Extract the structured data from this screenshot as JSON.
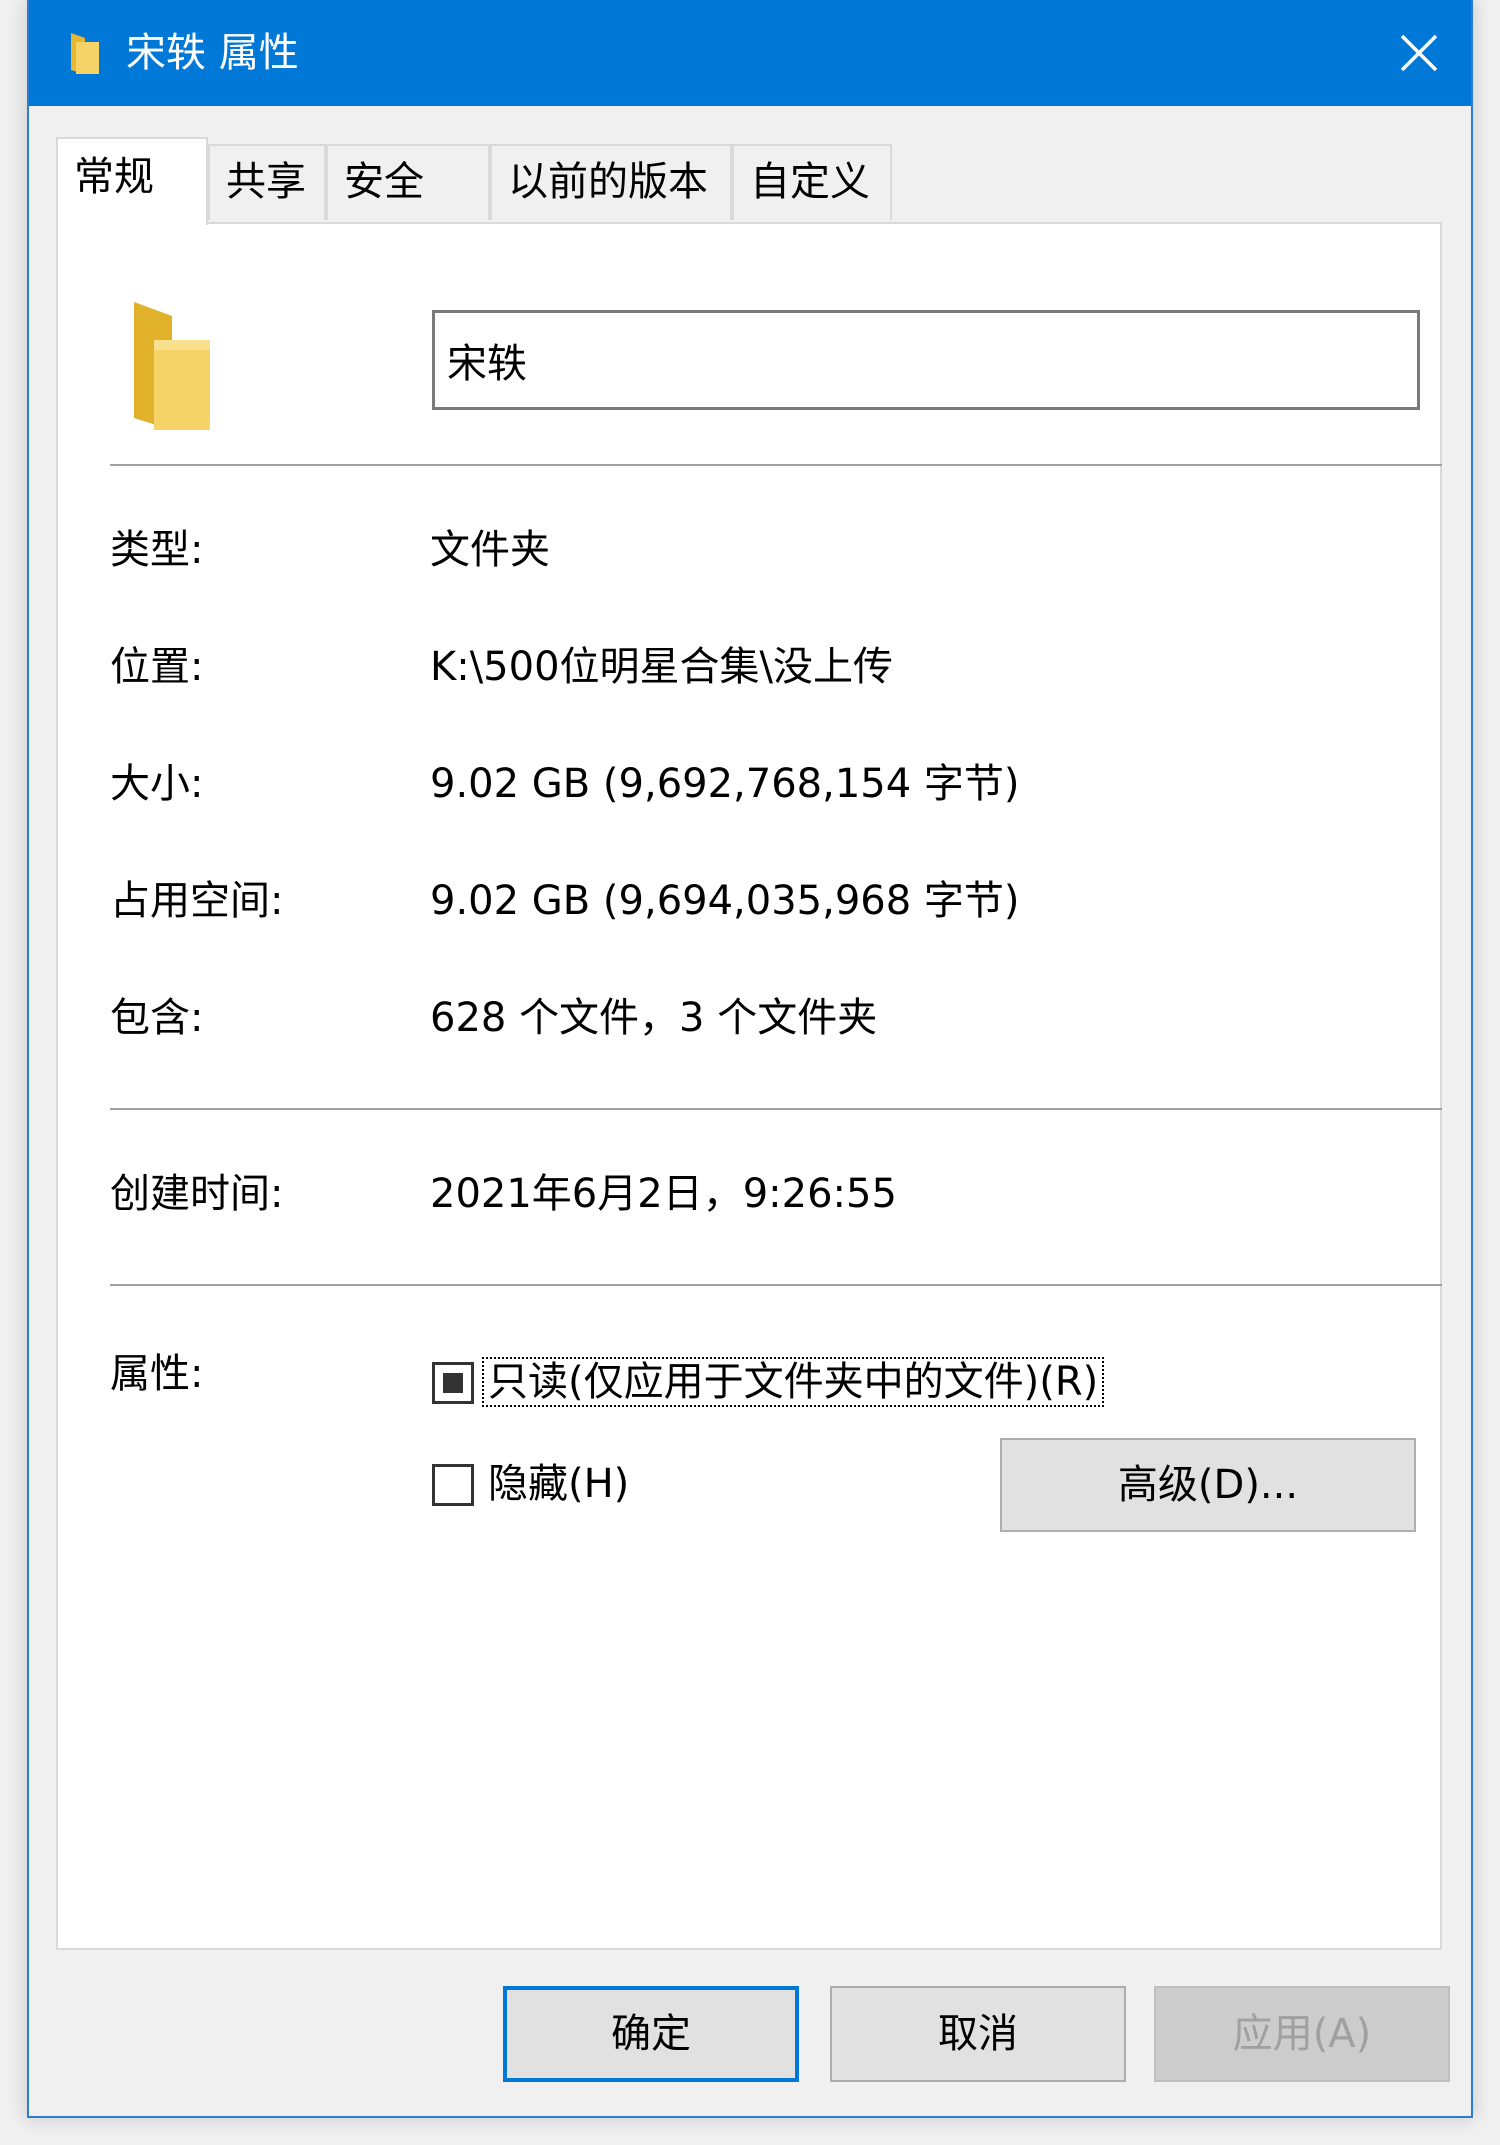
{
  "window": {
    "title": "宋轶 属性",
    "colors": {
      "titlebar": "#0078d7",
      "folder": "#f6d366",
      "accent": "#0078d7"
    }
  },
  "tabs": [
    {
      "label": "常规",
      "active": true
    },
    {
      "label": "共享",
      "active": false
    },
    {
      "label": "安全",
      "active": false
    },
    {
      "label": "以前的版本",
      "active": false
    },
    {
      "label": "自定义",
      "active": false
    }
  ],
  "general": {
    "name": "宋轶",
    "fields": {
      "type": {
        "label": "类型:",
        "value": "文件夹"
      },
      "location": {
        "label": "位置:",
        "value": "K:\\500位明星合集\\没上传"
      },
      "size": {
        "label": "大小:",
        "value": "9.02 GB (9,692,768,154 字节)"
      },
      "disk_size": {
        "label": "占用空间:",
        "value": "9.02 GB (9,694,035,968 字节)"
      },
      "contains": {
        "label": "包含:",
        "value": "628 个文件，3 个文件夹"
      },
      "created": {
        "label": "创建时间:",
        "value": "2021年6月2日，9:26:55"
      }
    },
    "attributes": {
      "label": "属性:",
      "readonly": {
        "label": "只读(仅应用于文件夹中的文件)(R)",
        "state": "indeterminate"
      },
      "hidden": {
        "label": "隐藏(H)",
        "checked": false
      },
      "advanced_button": "高级(D)..."
    }
  },
  "footer": {
    "ok": "确定",
    "cancel": "取消",
    "apply": "应用(A)"
  }
}
